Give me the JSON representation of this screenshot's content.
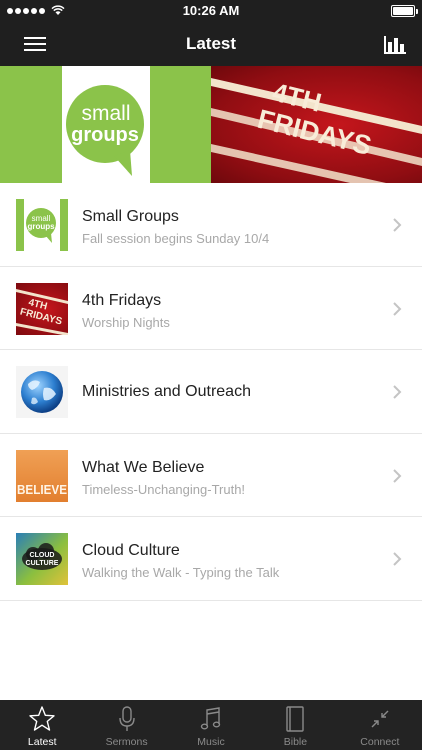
{
  "status_bar": {
    "time": "10:26 AM"
  },
  "nav": {
    "title": "Latest",
    "menu_icon": "hamburger-menu-icon",
    "chart_icon": "bar-chart-icon"
  },
  "hero": {
    "left_text_line1": "small",
    "left_text_line2": "groups",
    "right_text_line1": "4TH",
    "right_text_line2": "FRIDAYS"
  },
  "items": [
    {
      "title": "Small Groups",
      "subtitle": "Fall session begins Sunday 10/4",
      "thumb_line1": "small",
      "thumb_line2": "groups"
    },
    {
      "title": "4th Fridays",
      "subtitle": "Worship Nights",
      "thumb_line1": "4TH",
      "thumb_line2": "FRIDAYS"
    },
    {
      "title": "Ministries and Outreach",
      "subtitle": ""
    },
    {
      "title": "What We Believe",
      "subtitle": "Timeless-Unchanging-Truth!",
      "thumb_text": "BELIEVE"
    },
    {
      "title": "Cloud Culture",
      "subtitle": "Walking the Walk - Typing the Talk",
      "thumb_line1": "CLOUD",
      "thumb_line2": "CULTURE"
    }
  ],
  "tabs": [
    {
      "label": "Latest",
      "icon": "star-icon",
      "active": true
    },
    {
      "label": "Sermons",
      "icon": "microphone-icon",
      "active": false
    },
    {
      "label": "Music",
      "icon": "music-note-icon",
      "active": false
    },
    {
      "label": "Bible",
      "icon": "book-icon",
      "active": false
    },
    {
      "label": "Connect",
      "icon": "connect-arrows-icon",
      "active": false
    }
  ],
  "colors": {
    "bar_background": "#1f1f1f",
    "tab_background": "#232323",
    "brand_green": "#8bc34a",
    "brand_red": "#b3121a",
    "subtitle_gray": "#a8a8a8"
  }
}
